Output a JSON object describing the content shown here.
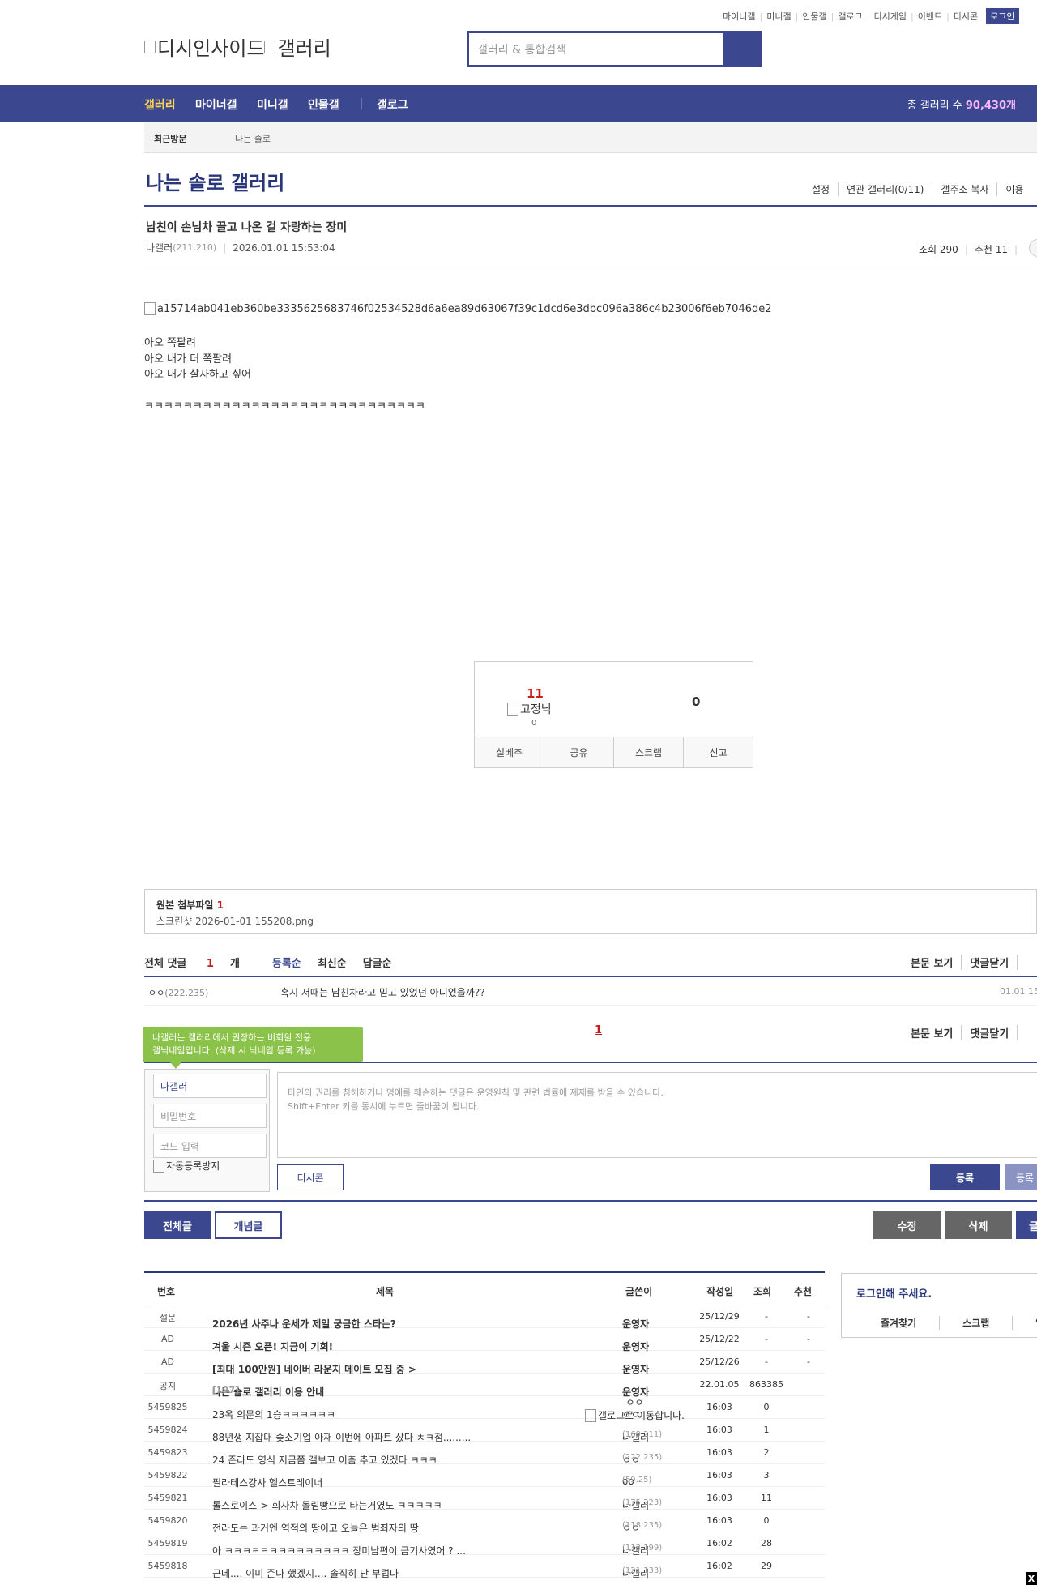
{
  "top_links": [
    "마이너갤",
    "미니갤",
    "인물갤",
    "갤로그",
    "디시게임",
    "이벤트",
    "디시콘"
  ],
  "login_label": "로그인",
  "logo": {
    "part1": "디시인사이드",
    "part2": "갤러리"
  },
  "search": {
    "placeholder": "갤러리 & 통합검색"
  },
  "nav": {
    "items": [
      "갤러리",
      "마이너갤",
      "미니갤",
      "인물갤",
      "갤로그"
    ],
    "count_label": "총 갤러리 수",
    "count_value": "90,430개"
  },
  "recent": {
    "label": "최근방문",
    "gallery": "나는 솔로"
  },
  "gallery": {
    "title": "나는 솔로 갤러리",
    "menu": [
      "설정",
      "연관 갤러리(0/11)",
      "갤주소 복사",
      "이용"
    ]
  },
  "post": {
    "title": "남친이 손님차 끌고 나온 걸 자랑하는 장미",
    "author": "나갤러",
    "ip": "(211.210)",
    "datetime": "2026.01.01 15:53:04",
    "views": "조회 290",
    "recommends": "추천 11",
    "image_alt": "a15714ab041eb360be3335625683746f02534528d6a6ea89d63067f39c1dcd6e3dbc096a386c4b23006f6eb7046de2",
    "lines": [
      "아오 쪽팔려",
      "아오 내가 더 쪽팔려",
      "아오 내가 살자하고 싶어",
      "ㅋㅋㅋㅋㅋㅋㅋㅋㅋㅋㅋㅋㅋㅋㅋㅋㅋㅋㅋㅋㅋㅋㅋㅋㅋㅋㅋㅋㅋ"
    ]
  },
  "vote": {
    "up": "11",
    "down": "0",
    "fixed_alt": "고정닉",
    "fixed_count": "0",
    "buttons": [
      "실베추",
      "공유",
      "스크랩",
      "신고"
    ]
  },
  "attach": {
    "label": "원본 첨부파일",
    "count": "1",
    "file": "스크린샷 2026-01-01 155208.png"
  },
  "comments": {
    "total_label": "전체 댓글",
    "total_count": "1",
    "total_unit": "개",
    "sorts": [
      "등록순",
      "최신순",
      "답글순"
    ],
    "right_menu": [
      "본문 보기",
      "댓글닫기"
    ],
    "items": [
      {
        "name": "ㅇㅇ",
        "ip": "(222.235)",
        "text": "혹시 저때는 남친차라고 믿고 있었던 아니었을까??",
        "date": "01.01 15"
      }
    ],
    "page": "1"
  },
  "write": {
    "tooltip_line1": "나갤러는 갤러리에서 권장하는 비회원 전용",
    "tooltip_line2": "갤닉네임입니다. (삭제 시 닉네임 등록 가능)",
    "nick": "나갤러",
    "password_ph": "비밀번호",
    "code_ph": "코드 입력",
    "captcha_alt": "자동등록방지",
    "textarea_line1": "타인의 권리를 침해하거나 명예를 훼손하는 댓글은 운영원칙 및 관련 법률에 제재를 받을 수 있습니다.",
    "textarea_line2": "Shift+Enter 키를 동시에 누르면 줄바꿈이 됩니다.",
    "dccon": "디시콘",
    "submit": "등록",
    "submit2": "등록"
  },
  "actions": {
    "all": "전체글",
    "concept": "개념글",
    "edit": "수정",
    "delete": "삭제",
    "write": "글"
  },
  "list": {
    "headers": [
      "번호",
      "제목",
      "글쓴이",
      "작성일",
      "조회",
      "추천"
    ],
    "rows": [
      {
        "no": "설문",
        "title": "2026년 사주나 운세가 제일 궁금한 스타는?",
        "writer": "운영자",
        "ip": "",
        "date": "25/12/29",
        "views": "-",
        "rec": "-",
        "bold": true
      },
      {
        "no": "AD",
        "title": "겨울 시즌 오픈! 지금이 기회!",
        "writer": "운영자",
        "ip": "",
        "date": "25/12/22",
        "views": "-",
        "rec": "-",
        "bold": true
      },
      {
        "no": "AD",
        "title": "[최대 100만원] 네이버 라운지 메이트 모집 중 >",
        "writer": "운영자",
        "ip": "",
        "date": "25/12/26",
        "views": "-",
        "rec": "-",
        "bold": true
      },
      {
        "no": "공지",
        "title": "나는 솔로 갤러리 이용 안내",
        "reply": "[197]",
        "writer": "운영자",
        "ip": "",
        "date": "22.01.05",
        "views": "863385",
        "rec": "",
        "bold": true
      },
      {
        "no": "5459825",
        "title": "23옥 의문의 1승ㅋㅋㅋㅋㅋㅋ",
        "writer": "ㅇㅇ",
        "ip": "",
        "date": "16:03",
        "views": "0",
        "rec": "",
        "bold": false
      },
      {
        "no": "5459824",
        "title": "88년생 지잡대 좆소기업 아재 이번에 아파트 샀다 ㅊㅋ점.........",
        "writer": "나갤러",
        "ip": "(169.211)",
        "date": "16:03",
        "views": "1",
        "rec": "",
        "bold": false
      },
      {
        "no": "5459823",
        "title": "24 즌라도 영식 지금쯤 갤보고 이춤 추고 있겠다 ㅋㅋㅋ",
        "writer": "ㅇㅇ",
        "ip": "(222.235)",
        "date": "16:03",
        "views": "2",
        "rec": "",
        "bold": false
      },
      {
        "no": "5459822",
        "title": "필라테스강사 헬스트레이너",
        "writer": "oo",
        "ip": "(59.25)",
        "date": "16:03",
        "views": "3",
        "rec": "",
        "bold": false
      },
      {
        "no": "5459821",
        "title": "롤스로이스-> 회사차 돌림빵으로 타는거였노 ㅋㅋㅋㅋㅋ",
        "writer": "나갤러",
        "ip": "(175.223)",
        "date": "16:03",
        "views": "11",
        "rec": "",
        "bold": false
      },
      {
        "no": "5459820",
        "title": "전라도는 과거엔 역적의 땅이고 오늘은 범죄자의 땅",
        "writer": "ㅇㅇ",
        "ip": "(118.235)",
        "date": "16:03",
        "views": "0",
        "rec": "",
        "bold": false
      },
      {
        "no": "5459819",
        "title": "아 ㅋㅋㅋㅋㅋㅋㅋㅋㅋㅋㅋㅋㅋㅋ 장미남편이 금기사였어 ? ...",
        "writer": "나갤러",
        "ip": "(113.199)",
        "date": "16:02",
        "views": "28",
        "rec": "",
        "bold": false
      },
      {
        "no": "5459818",
        "title": "근데.... 이미 존나 했겠지.... 솔직히 난 부럽다",
        "writer": "나갤러",
        "ip": "(121.133)",
        "date": "16:02",
        "views": "29",
        "rec": "",
        "bold": false
      }
    ]
  },
  "login_box": {
    "title": "로그인해 주세요.",
    "menu": [
      "즐겨찾기",
      "스크랩",
      "알림"
    ]
  },
  "gallog_tip": {
    "line1": "ㅇㅇ",
    "line2": "갤로그로 이동합니다."
  },
  "close": "X"
}
